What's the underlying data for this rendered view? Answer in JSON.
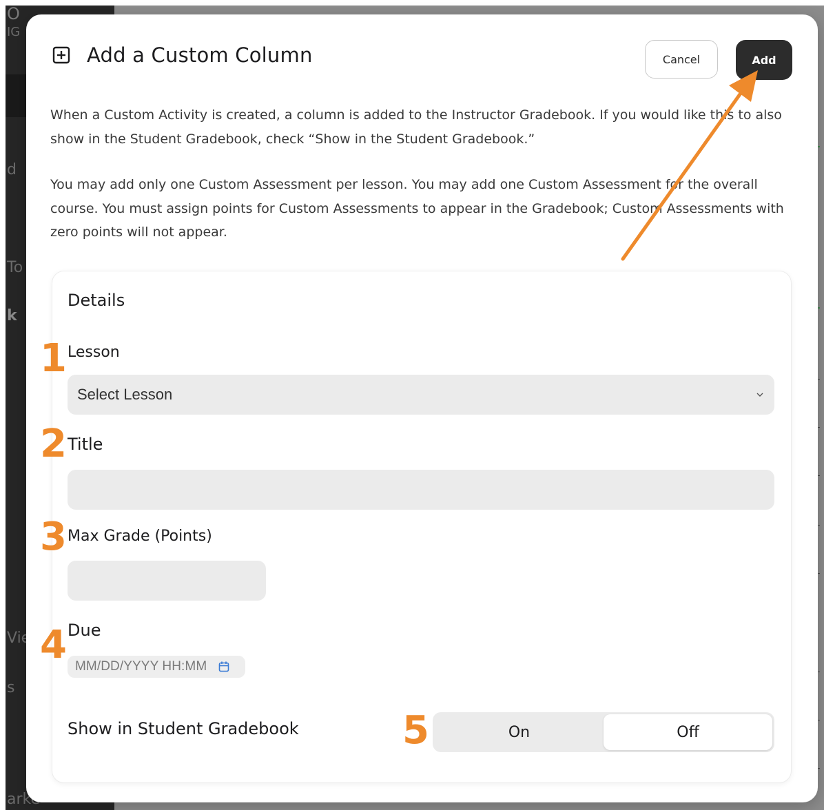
{
  "background": {
    "sidebar_fragments": [
      "O",
      "IG",
      "d",
      "To",
      "k",
      "Vie",
      "s",
      "arke"
    ]
  },
  "modal": {
    "title": "Add a Custom Column",
    "cancel_label": "Cancel",
    "add_label": "Add",
    "paragraph_1": "When a Custom Activity is created, a column is added to the Instructor Gradebook. If you would like this to also show in the Student Gradebook, check “Show in the Student Gradebook.”",
    "paragraph_2": "You may add only one Custom Assessment per lesson. You may add one Custom Assessment for the overall course. You must assign points for Custom Assessments to appear in the Gradebook; Custom Assessments with zero points will not appear."
  },
  "details": {
    "title": "Details",
    "lesson": {
      "label": "Lesson",
      "value": "Select Lesson"
    },
    "title_field": {
      "label": "Title",
      "value": ""
    },
    "max_grade": {
      "label": "Max Grade (Points)",
      "value": ""
    },
    "due": {
      "label": "Due",
      "placeholder": "MM/DD/YYYY HH:MM"
    },
    "show_in_student_gradebook": {
      "label": "Show in Student Gradebook",
      "options": [
        "On",
        "Off"
      ],
      "selected": "Off"
    }
  },
  "annotations": {
    "numbers": [
      "1",
      "2",
      "3",
      "4",
      "5"
    ],
    "color": "#ee8a2c"
  },
  "colors": {
    "add_button": "#2c2c2c",
    "input_bg": "#ebebeb",
    "annotation": "#ee8a2c"
  }
}
